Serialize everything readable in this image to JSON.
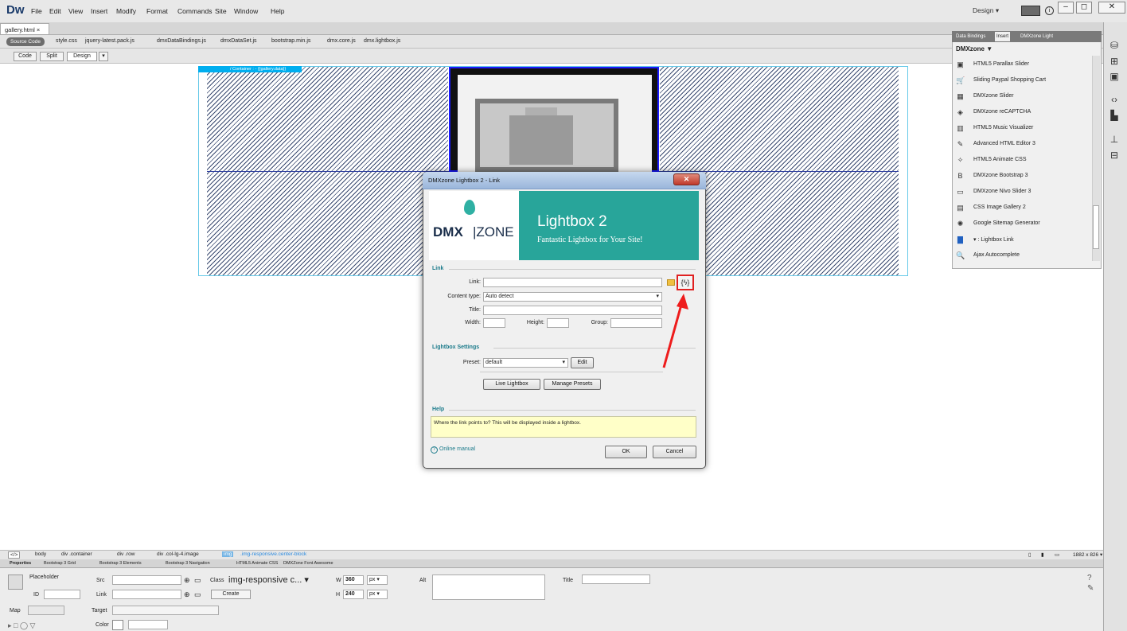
{
  "app": {
    "logo": "Dw",
    "menus": [
      "File",
      "Edit",
      "View",
      "Insert",
      "Modify",
      "Format",
      "Commands",
      "Site",
      "Window",
      "Help"
    ],
    "workspace": "Design",
    "win_buttons": [
      "–",
      "◻",
      "✕"
    ]
  },
  "document": {
    "tab": "gallery.html",
    "close": "×"
  },
  "related_files": {
    "source_label": "Source Code",
    "files": [
      "style.css",
      "jquery-latest.pack.js",
      "dmxDataBindings.js",
      "dmxDataSet.js",
      "bootstrap.min.js",
      "dmx.core.js",
      "dmx.lightbox.js"
    ]
  },
  "view": {
    "code": "Code",
    "split": "Split",
    "design": "Design"
  },
  "canvas": {
    "container_label": "/ Container : - {{gallery.data}}"
  },
  "panel": {
    "tabs": [
      "Data Bindings",
      "Insert",
      "DMXzone Light"
    ],
    "category": "DMXzone ▼",
    "items": [
      {
        "label": "HTML5 Parallax Slider",
        "icon": "▣"
      },
      {
        "label": "Sliding Paypal Shopping Cart",
        "icon": "🛒"
      },
      {
        "label": "DMXzone Slider",
        "icon": "▦"
      },
      {
        "label": "DMXzone reCAPTCHA",
        "icon": "◈"
      },
      {
        "label": "HTML5 Music Visualizer",
        "icon": "▥"
      },
      {
        "label": "Advanced HTML Editor 3",
        "icon": "✎"
      },
      {
        "label": "HTML5 Animate CSS",
        "icon": "✧"
      },
      {
        "label": "DMXzone Bootstrap 3",
        "icon": "B"
      },
      {
        "label": "DMXzone Nivo Slider 3",
        "icon": "▭"
      },
      {
        "label": "CSS Image Gallery 2",
        "icon": "▤"
      },
      {
        "label": "Google Sitemap Generator",
        "icon": "✺"
      },
      {
        "label": "▾ : Lightbox Link",
        "icon": "▇"
      },
      {
        "label": "Ajax Autocomplete",
        "icon": "🔍"
      }
    ]
  },
  "dialog": {
    "title": "DMXzone Lightbox 2 - Link",
    "close": "✕",
    "brand": {
      "dmx": "DMX",
      "zone": "|ZONE",
      "product": "Lightbox 2",
      "tagline": "Fantastic Lightbox for Your Site!"
    },
    "link_section": "Link",
    "link_label": "Link:",
    "link_value": "",
    "content_type_label": "Content type:",
    "content_type_value": "Auto detect",
    "title_label": "Title:",
    "width_label": "Width:",
    "height_label": "Height:",
    "group_label": "Group:",
    "settings_section": "Lightbox Settings",
    "preset_label": "Preset:",
    "preset_value": "default",
    "edit": "Edit",
    "live_lightbox": "Live Lightbox",
    "manage_presets": "Manage Presets",
    "help_section": "Help",
    "help_text": "Where the link points to? This will be displayed inside a lightbox.",
    "online_manual": "Online manual",
    "ok": "OK",
    "cancel": "Cancel",
    "dynamic_icon": "{ϟ}"
  },
  "tag_selector": {
    "tags": [
      "</>",
      "body",
      "div .container",
      "div .row",
      "div .col-lg-4.image"
    ],
    "current": "img",
    "current_class": ".img-responsive.center-block",
    "dimensions": "1882 x 826 ▾"
  },
  "inspector": {
    "tabs": [
      "Properties",
      "Bootstrap 3 Grid",
      "Bootstrap 3 Elements",
      "Bootstrap 3 Navigation",
      "HTML5 Animate CSS",
      "DMXZone Font Awesome"
    ],
    "placeholder": "Placeholder",
    "id_label": "ID",
    "src_label": "Src",
    "link_label": "Link",
    "class_label": "Class",
    "class_value": "img-responsive c...",
    "create": "Create",
    "w_label": "W",
    "w_value": "360",
    "h_label": "H",
    "h_value": "240",
    "unit": "px ▾",
    "alt_label": "Alt",
    "title_label": "Title",
    "map_label": "Map",
    "target_label": "Target",
    "color_label": "Color"
  }
}
